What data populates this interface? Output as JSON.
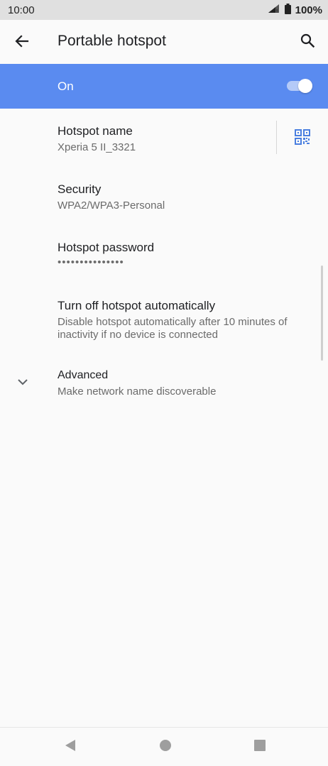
{
  "status_bar": {
    "time": "10:00",
    "battery": "100%"
  },
  "app_bar": {
    "title": "Portable hotspot"
  },
  "master_switch": {
    "label": "On",
    "state": "on",
    "accent": "#5a8bf0"
  },
  "settings": {
    "hotspot_name": {
      "title": "Hotspot name",
      "value": "Xperia 5 II_3321"
    },
    "security": {
      "title": "Security",
      "value": "WPA2/WPA3-Personal"
    },
    "password": {
      "title": "Hotspot password",
      "value": "•••••••••••••••"
    },
    "auto_off": {
      "title": "Turn off hotspot automatically",
      "line1": "Disable hotspot automatically after 10 minutes of",
      "line2": "inactivity if no device is connected"
    },
    "advanced": {
      "title": "Advanced",
      "value": "Make network name discoverable"
    }
  },
  "icons": {
    "back": "arrow-left-icon",
    "search": "search-icon",
    "qr": "qr-code-icon",
    "expand": "chevron-down-icon",
    "nav_back": "triangle-back-icon",
    "nav_home": "circle-home-icon",
    "nav_recents": "square-recents-icon"
  }
}
